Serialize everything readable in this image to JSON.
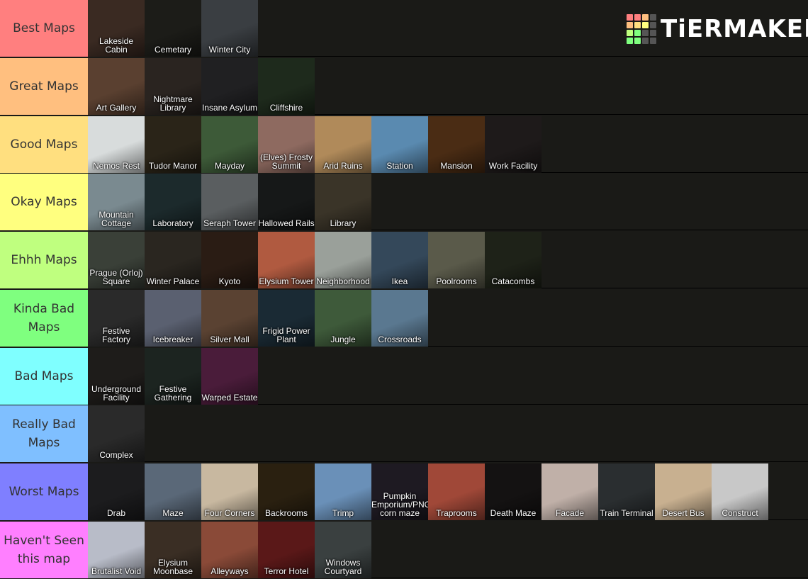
{
  "logo": {
    "text": "TiERMAKER",
    "grid_colors": [
      "#ff7f7f",
      "#ff7f7f",
      "#ffbf7f",
      "#555",
      "#ffbf7f",
      "#ffdf7f",
      "#ffff7f",
      "#555",
      "#bfff7f",
      "#7fff7f",
      "#555",
      "#555",
      "#7fff7f",
      "#7fff7f",
      "#555",
      "#555"
    ]
  },
  "tiers": [
    {
      "label": "Best Maps",
      "color": "#ff7f7f",
      "items": [
        {
          "name": "Lakeside Cabin",
          "bg": "#3a2a22"
        },
        {
          "name": "Cemetary",
          "bg": "#1c1c18"
        },
        {
          "name": "Winter City",
          "bg": "#3a3e42"
        }
      ]
    },
    {
      "label": "Great Maps",
      "color": "#ffbf7f",
      "items": [
        {
          "name": "Art Gallery",
          "bg": "#5a4030"
        },
        {
          "name": "Nightmare Library",
          "bg": "#2a2420"
        },
        {
          "name": "Insane Asylum",
          "bg": "#202022"
        },
        {
          "name": "Cliffshire",
          "bg": "#1e2a1c"
        }
      ]
    },
    {
      "label": "Good Maps",
      "color": "#ffdf7f",
      "items": [
        {
          "name": "Nemos Rest",
          "bg": "#d8dcdc"
        },
        {
          "name": "Tudor Manor",
          "bg": "#2a2418"
        },
        {
          "name": "Mayday",
          "bg": "#3d5a38"
        },
        {
          "name": "(Elves) Frosty Summit",
          "bg": "#8e6a60"
        },
        {
          "name": "Arid Ruins",
          "bg": "#b08a5a"
        },
        {
          "name": "Station",
          "bg": "#5a8ab0"
        },
        {
          "name": "Mansion",
          "bg": "#4a2c14"
        },
        {
          "name": "Work Facility",
          "bg": "#1e1a1a"
        }
      ]
    },
    {
      "label": "Okay Maps",
      "color": "#ffff7f",
      "items": [
        {
          "name": "Mountain Cottage",
          "bg": "#7a8a90"
        },
        {
          "name": "Laboratory",
          "bg": "#1c2a2c"
        },
        {
          "name": "Seraph Tower",
          "bg": "#5a5e60"
        },
        {
          "name": "Hallowed Rails",
          "bg": "#161818"
        },
        {
          "name": "Library",
          "bg": "#3a3428"
        }
      ]
    },
    {
      "label": "Ehhh Maps",
      "color": "#bfff7f",
      "items": [
        {
          "name": "Prague (Orloj) Square",
          "bg": "#3a4038"
        },
        {
          "name": "Winter Palace",
          "bg": "#2a2620"
        },
        {
          "name": "Kyoto",
          "bg": "#2a1c14"
        },
        {
          "name": "Elysium Tower",
          "bg": "#b05a40"
        },
        {
          "name": "Neighborhood",
          "bg": "#9aa09a"
        },
        {
          "name": "Ikea",
          "bg": "#34485a"
        },
        {
          "name": "Poolrooms",
          "bg": "#5a5a4a"
        },
        {
          "name": "Catacombs",
          "bg": "#1e2218"
        }
      ]
    },
    {
      "label": "Kinda Bad Maps",
      "color": "#7fff7f",
      "items": [
        {
          "name": "Festive Factory",
          "bg": "#2a2a2a"
        },
        {
          "name": "Icebreaker",
          "bg": "#5a6070"
        },
        {
          "name": "Silver Mall",
          "bg": "#5a4232"
        },
        {
          "name": "Frigid Power Plant",
          "bg": "#1a2a34"
        },
        {
          "name": "Jungle",
          "bg": "#3e5a3a"
        },
        {
          "name": "Crossroads",
          "bg": "#5a7890"
        }
      ]
    },
    {
      "label": "Bad Maps",
      "color": "#7fffff",
      "items": [
        {
          "name": "Underground Facility",
          "bg": "#1e1c1a"
        },
        {
          "name": "Festive Gathering",
          "bg": "#1c2420"
        },
        {
          "name": "Warped Estate",
          "bg": "#4a1c3a"
        }
      ]
    },
    {
      "label": "Really Bad Maps",
      "color": "#7fbfff",
      "items": [
        {
          "name": "Complex",
          "bg": "#2a2a2a"
        }
      ]
    },
    {
      "label": "Worst Maps",
      "color": "#7f7fff",
      "items": [
        {
          "name": "Drab",
          "bg": "#1c1c1e"
        },
        {
          "name": "Maze",
          "bg": "#5a6878"
        },
        {
          "name": "Four Corners",
          "bg": "#c8b8a0"
        },
        {
          "name": "Backrooms",
          "bg": "#2a2010"
        },
        {
          "name": "Trimp",
          "bg": "#6a90b8"
        },
        {
          "name": "Pumpkin Emporium/PNG corn maze",
          "bg": "#1e1a22"
        },
        {
          "name": "Traprooms",
          "bg": "#a04838"
        },
        {
          "name": "Death Maze",
          "bg": "#141212"
        },
        {
          "name": "Facade",
          "bg": "#c0b0a8"
        },
        {
          "name": "Train Terminal",
          "bg": "#2a2e30"
        },
        {
          "name": "Desert Bus",
          "bg": "#c8b090"
        },
        {
          "name": "Construct",
          "bg": "#c8c8c8"
        }
      ]
    },
    {
      "label": "Haven't Seen this map",
      "color": "#ff7fff",
      "items": [
        {
          "name": "Brutalist Void",
          "bg": "#b8bcc8"
        },
        {
          "name": "Elysium Moonbase",
          "bg": "#3a2e24"
        },
        {
          "name": "Alleyways",
          "bg": "#8a4a38"
        },
        {
          "name": "Terror Hotel",
          "bg": "#5a1818"
        },
        {
          "name": "Windows Courtyard",
          "bg": "#3a4040"
        }
      ]
    }
  ]
}
